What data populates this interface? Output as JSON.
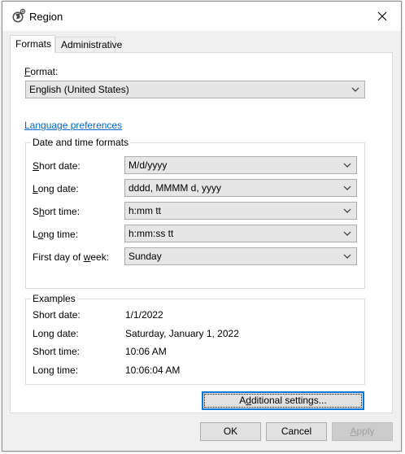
{
  "window": {
    "title": "Region",
    "close_label": "✕"
  },
  "tabs": [
    {
      "label": "Formats",
      "active": true
    },
    {
      "label": "Administrative",
      "active": false
    }
  ],
  "format": {
    "label_prefix": "",
    "label_ul": "F",
    "label_rest": "ormat:",
    "value": "English (United States)"
  },
  "language_link": "Language preferences",
  "date_time_formats": {
    "title": "Date and time formats",
    "rows": [
      {
        "label_pre": "",
        "label_ul": "S",
        "label_post": "hort date:",
        "value": "M/d/yyyy"
      },
      {
        "label_pre": "",
        "label_ul": "L",
        "label_post": "ong date:",
        "value": "dddd, MMMM d, yyyy"
      },
      {
        "label_pre": "S",
        "label_ul": "h",
        "label_post": "ort time:",
        "value": "h:mm tt"
      },
      {
        "label_pre": "L",
        "label_ul": "o",
        "label_post": "ng time:",
        "value": "h:mm:ss tt"
      },
      {
        "label_pre": "First day of ",
        "label_ul": "w",
        "label_post": "eek:",
        "value": "Sunday"
      }
    ]
  },
  "examples": {
    "title": "Examples",
    "rows": [
      {
        "label": "Short date:",
        "value": "1/1/2022"
      },
      {
        "label": "Long date:",
        "value": "Saturday, January 1, 2022"
      },
      {
        "label": "Short time:",
        "value": "10:06 AM"
      },
      {
        "label": "Long time:",
        "value": "10:06:04 AM"
      }
    ]
  },
  "additional_settings": {
    "pre": "A",
    "ul": "d",
    "post": "ditional settings..."
  },
  "buttons": {
    "ok": "OK",
    "cancel": "Cancel",
    "apply_ul": "A",
    "apply_rest": "pply"
  },
  "colors": {
    "accent": "#0078d7",
    "link": "#0066cc",
    "dialog_bg": "#f0f0f0"
  }
}
